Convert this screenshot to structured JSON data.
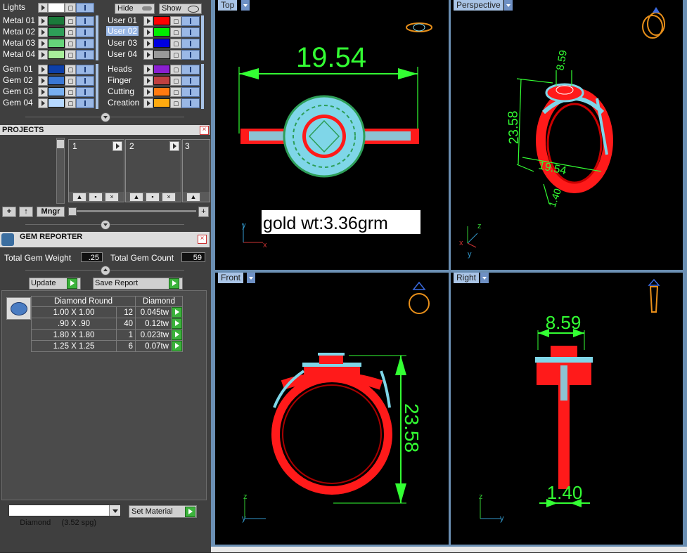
{
  "lights_panel": {
    "lights_label": "Lights",
    "hide_label": "Hide",
    "show_label": "Show",
    "metal_layers": [
      {
        "label": "Metal 01",
        "color": "#1a7a3a"
      },
      {
        "label": "Metal 02",
        "color": "#2e9e58"
      },
      {
        "label": "Metal 03",
        "color": "#66d47a"
      },
      {
        "label": "Metal 04",
        "color": "#a8ef9a"
      }
    ],
    "user_layers": [
      {
        "label": "User 01",
        "color": "#ff0000"
      },
      {
        "label": "User 02",
        "color": "#00ee00"
      },
      {
        "label": "User 03",
        "color": "#0000e0"
      },
      {
        "label": "User 04",
        "color": "#9a9a9a"
      }
    ],
    "gem_layers": [
      {
        "label": "Gem 01",
        "color": "#0d3fa8"
      },
      {
        "label": "Gem 02",
        "color": "#3a78d6"
      },
      {
        "label": "Gem 03",
        "color": "#78b0f0"
      },
      {
        "label": "Gem 04",
        "color": "#b6d8ff"
      }
    ],
    "other_layers": [
      {
        "label": "Heads",
        "color": "#8a1fd0"
      },
      {
        "label": "Finger",
        "color": "#c04040"
      },
      {
        "label": "Cutting",
        "color": "#ff7a10"
      },
      {
        "label": "Creation",
        "color": "#ffaa10"
      }
    ]
  },
  "projects": {
    "title": "PROJECTS",
    "slots": [
      "1",
      "2",
      "3"
    ],
    "mngr_label": "Mngr"
  },
  "gem_reporter": {
    "title": "GEM REPORTER",
    "total_weight_label": "Total Gem Weight",
    "total_weight_value": ".25",
    "total_count_label": "Total Gem Count",
    "total_count_value": "59",
    "update_label": "Update",
    "save_report_label": "Save Report",
    "table_headers": [
      "Diamond Round",
      "Diamond"
    ],
    "rows": [
      {
        "size": "1.00 X 1.00",
        "count": "12",
        "weight": "0.045tw"
      },
      {
        "size": ".90 X .90",
        "count": "40",
        "weight": "0.12tw"
      },
      {
        "size": "1.80 X 1.80",
        "count": "1",
        "weight": "0.023tw"
      },
      {
        "size": "1.25 X 1.25",
        "count": "6",
        "weight": "0.07tw"
      }
    ],
    "material_value": "Diamond     (3.52 spg)",
    "set_material_label": "Set Material"
  },
  "viewports": {
    "top": {
      "label": "Top",
      "dimension": "19.54",
      "note": "gold wt:3.36grm",
      "axis_y": "y",
      "axis_x": "x"
    },
    "perspective": {
      "label": "Perspective",
      "dim_top": "8.59",
      "dim_height": "23.58",
      "dim_width": "19.54",
      "dim_band": "1.40",
      "axis_z": "z",
      "axis_x": "x",
      "axis_y": "y"
    },
    "front": {
      "label": "Front",
      "dimension": "23.58",
      "axis_z": "z",
      "axis_y": "y"
    },
    "right": {
      "label": "Right",
      "dim_top": "8.59",
      "dim_band": "1.40",
      "axis_z": "z",
      "axis_y": "y"
    }
  },
  "colors": {
    "metal_red": "#ff1a1a",
    "gem_cyan": "#7fd6e8",
    "dimension_green": "#33ff33",
    "viewport_bg": "#000000"
  }
}
